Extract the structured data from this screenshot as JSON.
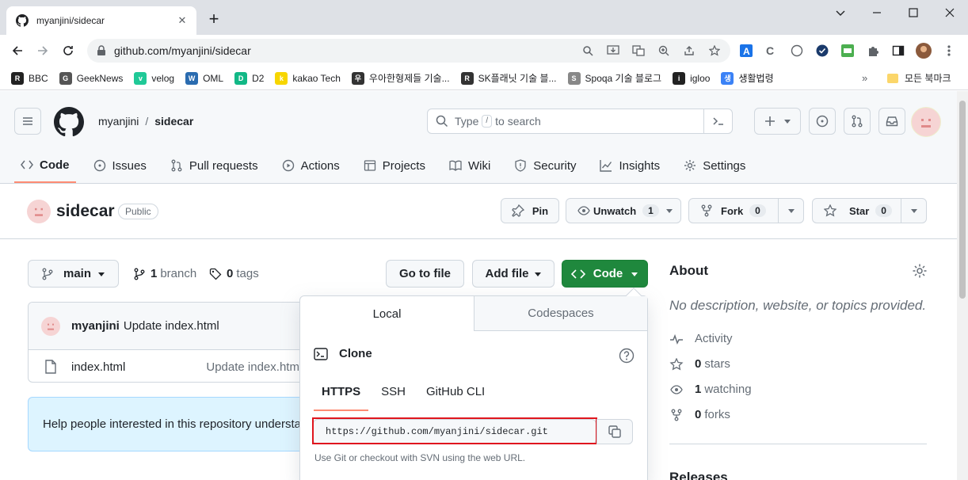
{
  "browser": {
    "tab_title": "myanjini/sidecar",
    "url": "github.com/myanjini/sidecar",
    "bookmarks": [
      {
        "label": "BBC",
        "color": "#222222",
        "mark": "R"
      },
      {
        "label": "GeekNews",
        "color": "#555555",
        "mark": "G"
      },
      {
        "label": "velog",
        "color": "#20c997",
        "mark": "v"
      },
      {
        "label": "OML",
        "color": "#2b6cb0",
        "mark": "W"
      },
      {
        "label": "D2",
        "color": "#12b886",
        "mark": "D"
      },
      {
        "label": "kakao Tech",
        "color": "#f7d600",
        "mark": "k"
      },
      {
        "label": "우아한형제들 기술...",
        "color": "#333333",
        "mark": "우"
      },
      {
        "label": "SK플래닛 기술 블...",
        "color": "#333333",
        "mark": "R"
      },
      {
        "label": "Spoqa 기술 블로그",
        "color": "#888888",
        "mark": "S"
      },
      {
        "label": "igloo",
        "color": "#222222",
        "mark": "i"
      },
      {
        "label": "생활법령",
        "color": "#3b82f6",
        "mark": "생"
      }
    ],
    "bookmarks_more": "»",
    "bookmarks_folder": "모든 북마크"
  },
  "header": {
    "owner": "myanjini",
    "separator": "/",
    "repo": "sidecar",
    "search_prefix": "Type",
    "search_key": "/",
    "search_suffix": "to search"
  },
  "repo_nav": [
    {
      "label": "Code",
      "icon": "code-icon",
      "active": true
    },
    {
      "label": "Issues",
      "icon": "issue-icon"
    },
    {
      "label": "Pull requests",
      "icon": "pull-request-icon"
    },
    {
      "label": "Actions",
      "icon": "play-icon"
    },
    {
      "label": "Projects",
      "icon": "table-icon"
    },
    {
      "label": "Wiki",
      "icon": "book-icon"
    },
    {
      "label": "Security",
      "icon": "shield-icon"
    },
    {
      "label": "Insights",
      "icon": "graph-icon"
    },
    {
      "label": "Settings",
      "icon": "gear-icon"
    }
  ],
  "repo": {
    "name": "sidecar",
    "visibility": "Public",
    "pin_label": "Pin",
    "watch_label": "Unwatch",
    "watch_count": "1",
    "fork_label": "Fork",
    "fork_count": "0",
    "star_label": "Star",
    "star_count": "0"
  },
  "files": {
    "branch": "main",
    "branch_count": "1",
    "branch_word": "branch",
    "tag_count": "0",
    "tag_word": "tags",
    "go_to_file": "Go to file",
    "add_file": "Add file",
    "code_button": "Code",
    "commit_author": "myanjini",
    "commit_message": "Update index.html",
    "rows": [
      {
        "name": "index.html",
        "message": "Update index.html"
      }
    ],
    "readme_help": "Help people interested in this repository understand your project by adding a README."
  },
  "clone": {
    "tab_local": "Local",
    "tab_codespaces": "Codespaces",
    "heading": "Clone",
    "protocols": [
      "HTTPS",
      "SSH",
      "GitHub CLI"
    ],
    "active_protocol": "HTTPS",
    "url": "https://github.com/myanjini/sidecar.git",
    "hint": "Use Git or checkout with SVN using the web URL.",
    "highlight_color": "#e0161e"
  },
  "about": {
    "title": "About",
    "description": "No description, website, or topics provided.",
    "activity": "Activity",
    "stars_count": "0",
    "stars_word": "stars",
    "watching_count": "1",
    "watching_word": "watching",
    "forks_count": "0",
    "forks_word": "forks",
    "releases": "Releases"
  },
  "colors": {
    "primary_green": "#1f883d",
    "active_tab_underline": "#fd8c73",
    "readme_banner": "#ddf4ff"
  }
}
